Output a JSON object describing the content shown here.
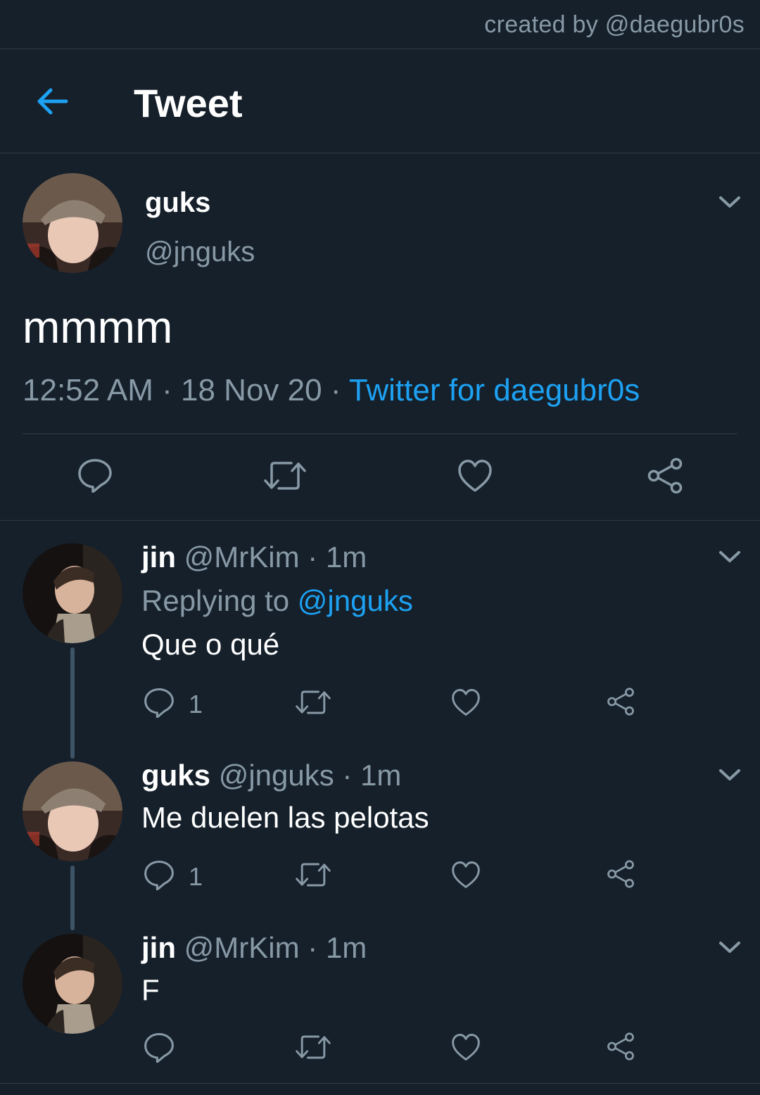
{
  "watermark": "created by @daegubr0s",
  "header": {
    "title": "Tweet"
  },
  "main_tweet": {
    "name": "guks",
    "handle": "@jnguks",
    "text": "mmmm",
    "time": "12:52 AM",
    "sep1": " · ",
    "date": "18 Nov 20",
    "sep2": " · ",
    "source": "Twitter for daegubr0s"
  },
  "replies": [
    {
      "name": "jin",
      "handle": "@MrKim",
      "time": "· 1m",
      "replying_prefix": "Replying to",
      "replying_to": "@jnguks",
      "text": "Que o qué",
      "reply_count": "1"
    },
    {
      "name": "guks",
      "handle": "@jnguks",
      "time": "· 1m",
      "text": "Me duelen las pelotas",
      "reply_count": "1"
    },
    {
      "name": "jin",
      "handle": "@MrKim",
      "time": "· 1m",
      "text": "F",
      "reply_count": ""
    }
  ],
  "colors": {
    "background": "#15202b",
    "accent": "#1da1f2",
    "secondary_text": "#8899a6",
    "divider": "#2f3b47"
  },
  "icons": [
    "back-arrow-icon",
    "chevron-down-icon",
    "reply-icon",
    "retweet-icon",
    "like-icon",
    "share-icon"
  ]
}
